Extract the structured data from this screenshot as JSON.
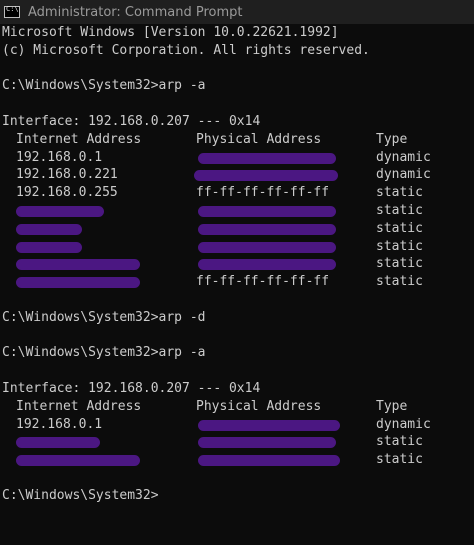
{
  "window": {
    "title": "Administrator: Command Prompt",
    "icon": "cmd-icon"
  },
  "console": {
    "banner": [
      "Microsoft Windows [Version 10.0.22621.1992]",
      "(c) Microsoft Corporation. All rights reserved."
    ],
    "prompt1": "C:\\Windows\\System32>arp -a",
    "interface1": "Interface: 192.168.0.207 --- 0x14",
    "headers": {
      "internet_address": "Internet Address",
      "physical_address": "Physical Address",
      "type": "Type"
    },
    "table1": [
      {
        "ip": "192.168.0.1",
        "mac": "",
        "type": "dynamic"
      },
      {
        "ip": "192.168.0.221",
        "mac": "",
        "type": "dynamic"
      },
      {
        "ip": "192.168.0.255",
        "mac": "ff-ff-ff-ff-ff-ff",
        "type": "static"
      },
      {
        "ip": "",
        "mac": "",
        "type": "static"
      },
      {
        "ip": "",
        "mac": "",
        "type": "static"
      },
      {
        "ip": "",
        "mac": "",
        "type": "static"
      },
      {
        "ip": "",
        "mac": "",
        "type": "static"
      },
      {
        "ip": "",
        "mac": "ff-ff-ff-ff-ff-ff",
        "type": "static"
      }
    ],
    "prompt2": "C:\\Windows\\System32>arp -d",
    "prompt3": "C:\\Windows\\System32>arp -a",
    "interface2": "Interface: 192.168.0.207 --- 0x14",
    "table2": [
      {
        "ip": "192.168.0.1",
        "mac": "",
        "type": "dynamic"
      },
      {
        "ip": "",
        "mac": "",
        "type": "static"
      },
      {
        "ip": "",
        "mac": "",
        "type": "static"
      }
    ],
    "prompt4": "C:\\Windows\\System32>",
    "redaction_color": "#4b1782"
  }
}
